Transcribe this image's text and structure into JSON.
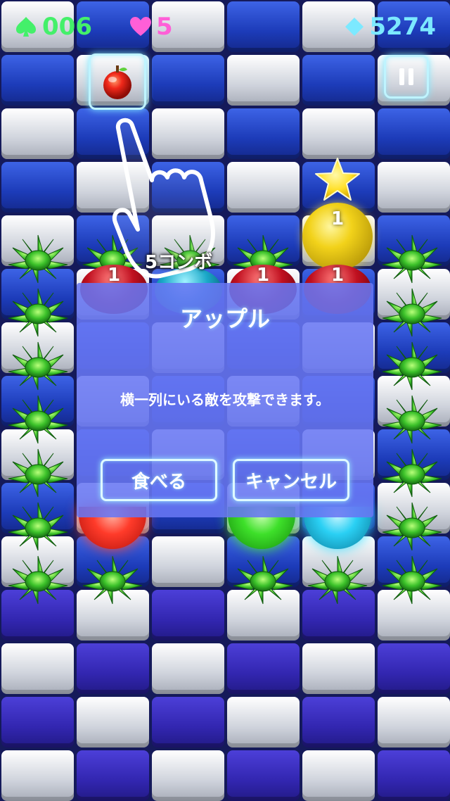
{
  "hud": {
    "moves": "006",
    "lives": "5",
    "gems": "5274",
    "colors": {
      "moves": "#44f06a",
      "lives": "#ff5fd7",
      "gems": "#7ce9ff"
    }
  },
  "icons": {
    "moves": "spade-icon",
    "lives": "heart-icon",
    "gems": "diamond-icon",
    "pause": "pause-icon",
    "item": "apple-icon",
    "tutorial": "pointing-hand-icon",
    "star": "star-icon"
  },
  "board": {
    "combo_text": "5コンボ",
    "orb_number": "1"
  },
  "dialog": {
    "title": "アップル",
    "message": "横一列にいる敵を攻撃できます。",
    "eat_label": "食べる",
    "cancel_label": "キャンセル"
  }
}
